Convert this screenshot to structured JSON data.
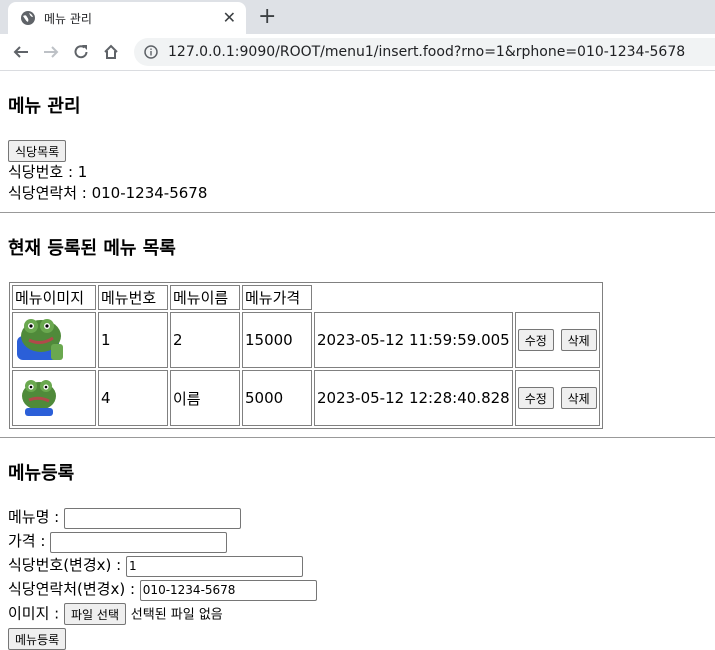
{
  "browser": {
    "tab_title": "메뉴 관리",
    "url": "127.0.0.1:9090/ROOT/menu1/insert.food?rno=1&rphone=010-1234-5678"
  },
  "page": {
    "heading": "메뉴 관리",
    "restaurant_list_button": "식당목록",
    "rno_line": "식당번호 : 1",
    "phone_line": "식당연락처 : 010-1234-5678",
    "list_heading": "현재 등록된 메뉴 목록",
    "table_headers": [
      "메뉴이미지",
      "메뉴번호",
      "메뉴이름",
      "메뉴가격"
    ],
    "rows": [
      {
        "no": "1",
        "name": "2",
        "price": "15000",
        "date": "2023-05-12 11:59:59.005",
        "edit": "수정",
        "delete": "삭제"
      },
      {
        "no": "4",
        "name": "이름",
        "price": "5000",
        "date": "2023-05-12 12:28:40.828",
        "edit": "수정",
        "delete": "삭제"
      }
    ],
    "form": {
      "heading": "메뉴등록",
      "name_label": "메뉴명 :",
      "name_value": "",
      "price_label": "가격 :",
      "price_value": "",
      "rno_label": "식당번호(변경x) :",
      "rno_value": "1",
      "phone_label": "식당연락처(변경x) :",
      "phone_value": "010-1234-5678",
      "image_label": "이미지 :",
      "file_button": "파일 선택",
      "file_status": "선택된 파일 없음",
      "submit_button": "메뉴등록"
    }
  }
}
